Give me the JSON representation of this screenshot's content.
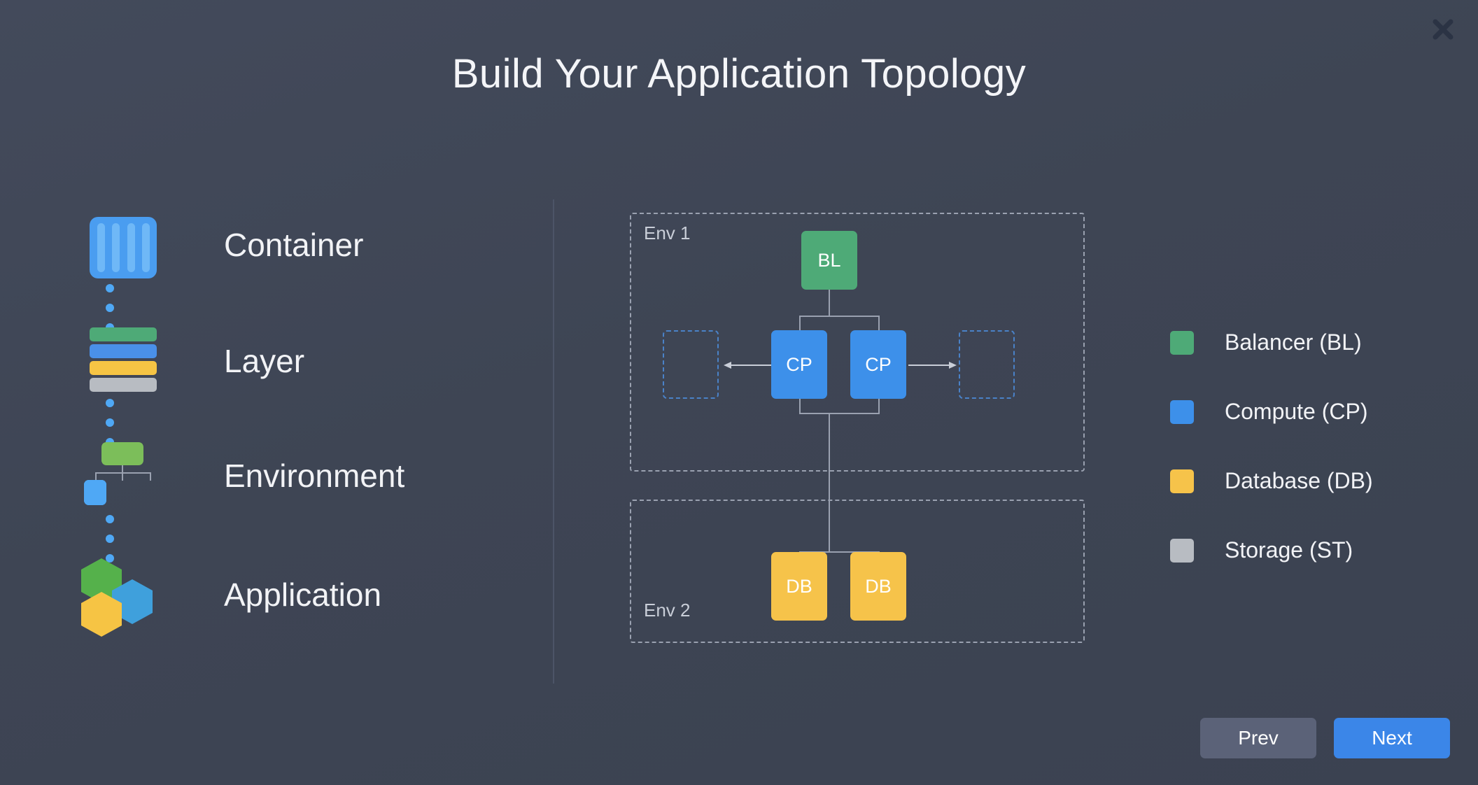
{
  "window": {
    "title": "Build Your Application Topology",
    "close_icon": "close-icon"
  },
  "concepts": [
    {
      "label": "Container",
      "icon": "container-icon"
    },
    {
      "label": "Layer",
      "icon": "layer-stack-icon"
    },
    {
      "label": "Environment",
      "icon": "environment-tree-icon"
    },
    {
      "label": "Application",
      "icon": "hexagon-cluster-icon"
    }
  ],
  "topology": {
    "environments": [
      {
        "id": "env-1",
        "label": "Env 1"
      },
      {
        "id": "env-2",
        "label": "Env 2"
      }
    ],
    "nodes": [
      {
        "id": "node-bl",
        "label": "BL",
        "type": "balancer",
        "env": "Env 1"
      },
      {
        "id": "node-cp-1",
        "label": "CP",
        "type": "compute",
        "env": "Env 1"
      },
      {
        "id": "node-cp-2",
        "label": "CP",
        "type": "compute",
        "env": "Env 1"
      },
      {
        "id": "node-db-1",
        "label": "DB",
        "type": "database",
        "env": "Env 2"
      },
      {
        "id": "node-db-2",
        "label": "DB",
        "type": "database",
        "env": "Env 2"
      }
    ],
    "slots": [
      {
        "id": "slot-left",
        "label": ""
      },
      {
        "id": "slot-right",
        "label": ""
      }
    ]
  },
  "legend": {
    "items": [
      {
        "label": "Balancer (BL)",
        "color": "#4eaa77"
      },
      {
        "label": "Compute (CP)",
        "color": "#3d90ea"
      },
      {
        "label": "Database (DB)",
        "color": "#f6c34a"
      },
      {
        "label": "Storage (ST)",
        "color": "#b8bcc2"
      }
    ]
  },
  "footer": {
    "prev_label": "Prev",
    "next_label": "Next"
  },
  "colors": {
    "background": "#3e4554",
    "accent_blue": "#3b86e8",
    "balancer_green": "#4eaa77",
    "compute_blue": "#3d90ea",
    "database_yellow": "#f6c34a",
    "storage_gray": "#b8bcc2",
    "edge_gray": "#9aa1b0",
    "slot_dash_blue": "#4a82c8"
  }
}
